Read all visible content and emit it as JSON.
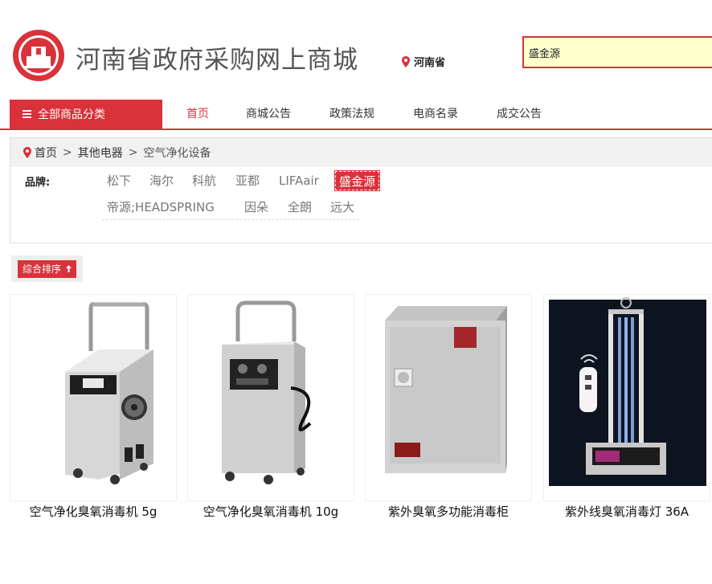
{
  "header": {
    "site_title": "河南省政府采购网上商城",
    "region": "河南省",
    "search_value": "盛金源"
  },
  "nav": {
    "category_button": "全部商品分类",
    "items": [
      "首页",
      "商城公告",
      "政策法规",
      "电商名录",
      "成交公告"
    ],
    "active_index": 0
  },
  "breadcrumb": {
    "home": "首页",
    "sep": ">",
    "level1": "其他电器",
    "level2": "空气净化设备"
  },
  "filter": {
    "brand_label": "品牌:",
    "brands_row1": [
      "松下",
      "海尔",
      "科航",
      "亚都",
      "LIFAair",
      "盛金源"
    ],
    "brands_row2": [
      "帝源;HEADSPRING",
      "因朵",
      "全朗",
      "远大"
    ],
    "active_brand": "盛金源"
  },
  "sort": {
    "label": "综合排序"
  },
  "products": [
    {
      "name": "空气净化臭氧消毒机 5g"
    },
    {
      "name": "空气净化臭氧消毒机 10g"
    },
    {
      "name": "紫外臭氧多功能消毒柜"
    },
    {
      "name": "紫外线臭氧消毒灯 36A"
    }
  ],
  "colors": {
    "accent": "#d9323a",
    "search_bg": "#ffffcc"
  }
}
